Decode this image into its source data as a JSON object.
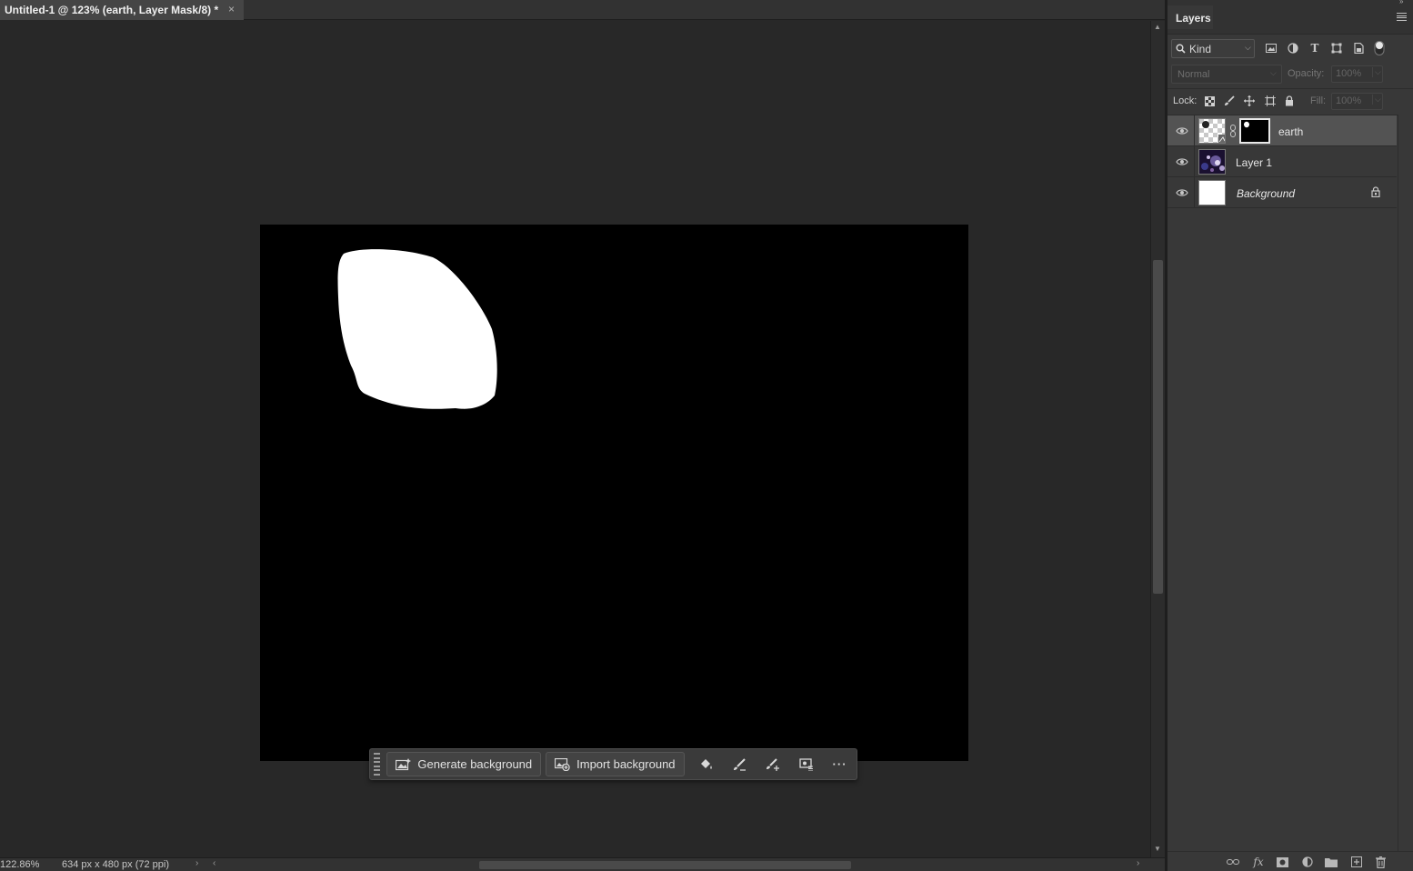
{
  "document_tab": {
    "title": "Untitled-1 @ 123% (earth, Layer Mask/8) *",
    "close_glyph": "×"
  },
  "status_bar": {
    "zoom": "122.86%",
    "doc_info": "634 px x 480 px (72 ppi)",
    "next_glyph": "›"
  },
  "taskbar": {
    "generate_label": "Generate background",
    "import_label": "Import background",
    "more_glyph": "···"
  },
  "layers_panel": {
    "title": "Layers",
    "filter_kind": "Kind",
    "blend_mode": "Normal",
    "opacity_label": "Opacity:",
    "opacity_value": "100%",
    "lock_label": "Lock:",
    "fill_label": "Fill:",
    "fill_value": "100%",
    "type_filter_glyph": "T",
    "layers": [
      {
        "name": "earth",
        "selected": true,
        "has_mask": true
      },
      {
        "name": "Layer 1",
        "selected": false,
        "has_mask": false
      },
      {
        "name": "Background",
        "selected": false,
        "locked": true,
        "italic": true
      }
    ],
    "footer_fx": "fx"
  },
  "colors": {
    "workspace": "#282828",
    "panel": "#383838",
    "selected_layer": "#535353",
    "canvas": "#000000",
    "mask_shape": "#ffffff"
  },
  "icons": [
    "search-icon",
    "image-filter-icon",
    "adjustment-filter-icon",
    "type-filter-icon",
    "shape-filter-icon",
    "smart-object-filter-icon",
    "filter-toggle-icon",
    "lock-transparent-icon",
    "lock-image-icon",
    "lock-position-icon",
    "lock-artboard-icon",
    "lock-all-icon",
    "eye-icon",
    "chain-link-icon",
    "lock-icon",
    "link-layers-icon",
    "fx-icon",
    "add-mask-icon",
    "adjustment-layer-icon",
    "folder-icon",
    "new-layer-icon",
    "trash-icon",
    "paint-bucket-icon",
    "brush-icon",
    "brush-plus-icon",
    "select-subject-icon",
    "more-icon",
    "generate-image-icon",
    "import-image-icon"
  ]
}
